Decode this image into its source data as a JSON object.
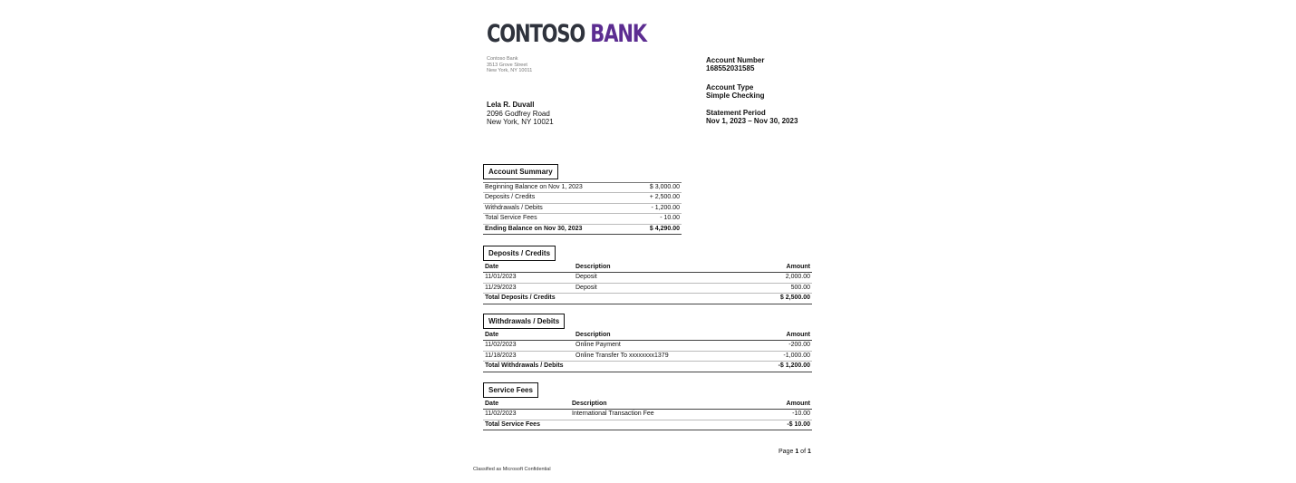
{
  "brand": {
    "word1": "CONTOSO",
    "word2": "BANK",
    "color_dark": "#2f333d",
    "color_accent": "#5c2d91"
  },
  "bank_address": [
    "Contoso Bank",
    "3513 Grove Street",
    "New York, NY 10011"
  ],
  "customer": {
    "name": "Lela R. Duvall",
    "street": "2096 Godfrey Road",
    "city": "New York, NY 10021"
  },
  "account": {
    "number_label": "Account Number",
    "number": "168552031585",
    "type_label": "Account Type",
    "type": "Simple Checking",
    "period_label": "Statement Period",
    "period": "Nov 1, 2023 – Nov 30, 2023"
  },
  "summary": {
    "title": "Account Summary",
    "rows": [
      {
        "label": "Beginning Balance on Nov 1, 2023",
        "value": "$ 3,000.00"
      },
      {
        "label": "Deposits / Credits",
        "value": "+ 2,500.00"
      },
      {
        "label": "Withdrawals / Debits",
        "value": "- 1,200.00"
      },
      {
        "label": "Total Service Fees",
        "value": "- 10.00"
      }
    ],
    "total": {
      "label": "Ending Balance on Nov 30, 2023",
      "value": "$ 4,290.00"
    }
  },
  "headers": {
    "date": "Date",
    "description": "Description",
    "amount": "Amount"
  },
  "deposits": {
    "title": "Deposits / Credits",
    "rows": [
      {
        "date": "11/01/2023",
        "description": "Deposit",
        "amount": "2,000.00"
      },
      {
        "date": "11/29/2023",
        "description": "Deposit",
        "amount": "500.00"
      }
    ],
    "total": {
      "label": "Total Deposits / Credits",
      "amount": "$ 2,500.00"
    }
  },
  "withdrawals": {
    "title": "Withdrawals / Debits",
    "rows": [
      {
        "date": "11/02/2023",
        "description": "Online Payment",
        "amount": "-200.00"
      },
      {
        "date": "11/18/2023",
        "description": "Online Transfer To xxxxxxxx1379",
        "amount": "-1,000.00"
      }
    ],
    "total": {
      "label": "Total Withdrawals / Debits",
      "amount": "-$ 1,200.00"
    }
  },
  "fees": {
    "title": "Service Fees",
    "rows": [
      {
        "date": "11/02/2023",
        "description": "International Transaction Fee",
        "amount": "-10.00"
      }
    ],
    "total": {
      "label": "Total Service Fees",
      "amount": "-$ 10.00"
    }
  },
  "footer": {
    "page_prefix": "Page",
    "page_current": "1",
    "page_of": "of",
    "page_total": "1",
    "classification": "Classified as Microsoft Confidential"
  }
}
